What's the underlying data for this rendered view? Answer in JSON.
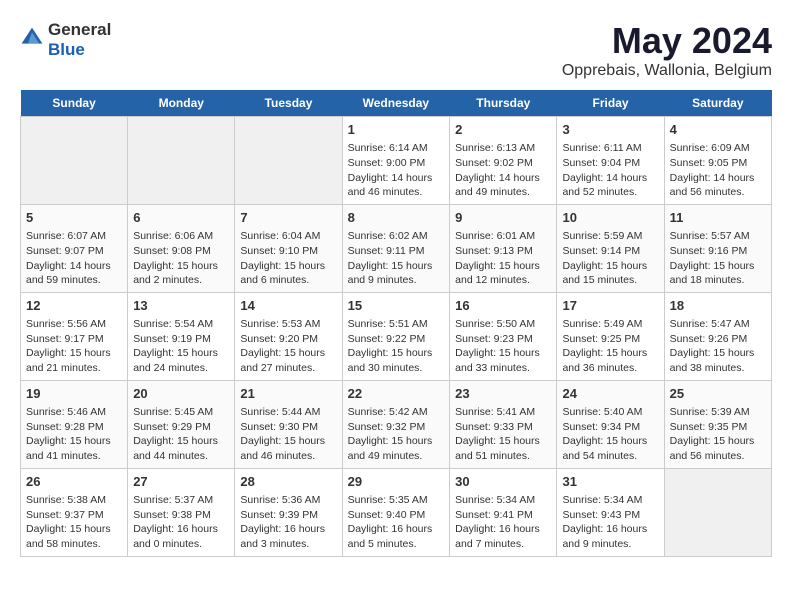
{
  "header": {
    "logo_general": "General",
    "logo_blue": "Blue",
    "title": "May 2024",
    "subtitle": "Opprebais, Wallonia, Belgium"
  },
  "days_of_week": [
    "Sunday",
    "Monday",
    "Tuesday",
    "Wednesday",
    "Thursday",
    "Friday",
    "Saturday"
  ],
  "weeks": [
    [
      {
        "day": "",
        "empty": true
      },
      {
        "day": "",
        "empty": true
      },
      {
        "day": "",
        "empty": true
      },
      {
        "day": "1",
        "sunrise": "6:14 AM",
        "sunset": "9:00 PM",
        "daylight": "14 hours and 46 minutes."
      },
      {
        "day": "2",
        "sunrise": "6:13 AM",
        "sunset": "9:02 PM",
        "daylight": "14 hours and 49 minutes."
      },
      {
        "day": "3",
        "sunrise": "6:11 AM",
        "sunset": "9:04 PM",
        "daylight": "14 hours and 52 minutes."
      },
      {
        "day": "4",
        "sunrise": "6:09 AM",
        "sunset": "9:05 PM",
        "daylight": "14 hours and 56 minutes."
      }
    ],
    [
      {
        "day": "5",
        "sunrise": "6:07 AM",
        "sunset": "9:07 PM",
        "daylight": "14 hours and 59 minutes."
      },
      {
        "day": "6",
        "sunrise": "6:06 AM",
        "sunset": "9:08 PM",
        "daylight": "15 hours and 2 minutes."
      },
      {
        "day": "7",
        "sunrise": "6:04 AM",
        "sunset": "9:10 PM",
        "daylight": "15 hours and 6 minutes."
      },
      {
        "day": "8",
        "sunrise": "6:02 AM",
        "sunset": "9:11 PM",
        "daylight": "15 hours and 9 minutes."
      },
      {
        "day": "9",
        "sunrise": "6:01 AM",
        "sunset": "9:13 PM",
        "daylight": "15 hours and 12 minutes."
      },
      {
        "day": "10",
        "sunrise": "5:59 AM",
        "sunset": "9:14 PM",
        "daylight": "15 hours and 15 minutes."
      },
      {
        "day": "11",
        "sunrise": "5:57 AM",
        "sunset": "9:16 PM",
        "daylight": "15 hours and 18 minutes."
      }
    ],
    [
      {
        "day": "12",
        "sunrise": "5:56 AM",
        "sunset": "9:17 PM",
        "daylight": "15 hours and 21 minutes."
      },
      {
        "day": "13",
        "sunrise": "5:54 AM",
        "sunset": "9:19 PM",
        "daylight": "15 hours and 24 minutes."
      },
      {
        "day": "14",
        "sunrise": "5:53 AM",
        "sunset": "9:20 PM",
        "daylight": "15 hours and 27 minutes."
      },
      {
        "day": "15",
        "sunrise": "5:51 AM",
        "sunset": "9:22 PM",
        "daylight": "15 hours and 30 minutes."
      },
      {
        "day": "16",
        "sunrise": "5:50 AM",
        "sunset": "9:23 PM",
        "daylight": "15 hours and 33 minutes."
      },
      {
        "day": "17",
        "sunrise": "5:49 AM",
        "sunset": "9:25 PM",
        "daylight": "15 hours and 36 minutes."
      },
      {
        "day": "18",
        "sunrise": "5:47 AM",
        "sunset": "9:26 PM",
        "daylight": "15 hours and 38 minutes."
      }
    ],
    [
      {
        "day": "19",
        "sunrise": "5:46 AM",
        "sunset": "9:28 PM",
        "daylight": "15 hours and 41 minutes."
      },
      {
        "day": "20",
        "sunrise": "5:45 AM",
        "sunset": "9:29 PM",
        "daylight": "15 hours and 44 minutes."
      },
      {
        "day": "21",
        "sunrise": "5:44 AM",
        "sunset": "9:30 PM",
        "daylight": "15 hours and 46 minutes."
      },
      {
        "day": "22",
        "sunrise": "5:42 AM",
        "sunset": "9:32 PM",
        "daylight": "15 hours and 49 minutes."
      },
      {
        "day": "23",
        "sunrise": "5:41 AM",
        "sunset": "9:33 PM",
        "daylight": "15 hours and 51 minutes."
      },
      {
        "day": "24",
        "sunrise": "5:40 AM",
        "sunset": "9:34 PM",
        "daylight": "15 hours and 54 minutes."
      },
      {
        "day": "25",
        "sunrise": "5:39 AM",
        "sunset": "9:35 PM",
        "daylight": "15 hours and 56 minutes."
      }
    ],
    [
      {
        "day": "26",
        "sunrise": "5:38 AM",
        "sunset": "9:37 PM",
        "daylight": "15 hours and 58 minutes."
      },
      {
        "day": "27",
        "sunrise": "5:37 AM",
        "sunset": "9:38 PM",
        "daylight": "16 hours and 0 minutes."
      },
      {
        "day": "28",
        "sunrise": "5:36 AM",
        "sunset": "9:39 PM",
        "daylight": "16 hours and 3 minutes."
      },
      {
        "day": "29",
        "sunrise": "5:35 AM",
        "sunset": "9:40 PM",
        "daylight": "16 hours and 5 minutes."
      },
      {
        "day": "30",
        "sunrise": "5:34 AM",
        "sunset": "9:41 PM",
        "daylight": "16 hours and 7 minutes."
      },
      {
        "day": "31",
        "sunrise": "5:34 AM",
        "sunset": "9:43 PM",
        "daylight": "16 hours and 9 minutes."
      },
      {
        "day": "",
        "empty": true
      }
    ]
  ]
}
